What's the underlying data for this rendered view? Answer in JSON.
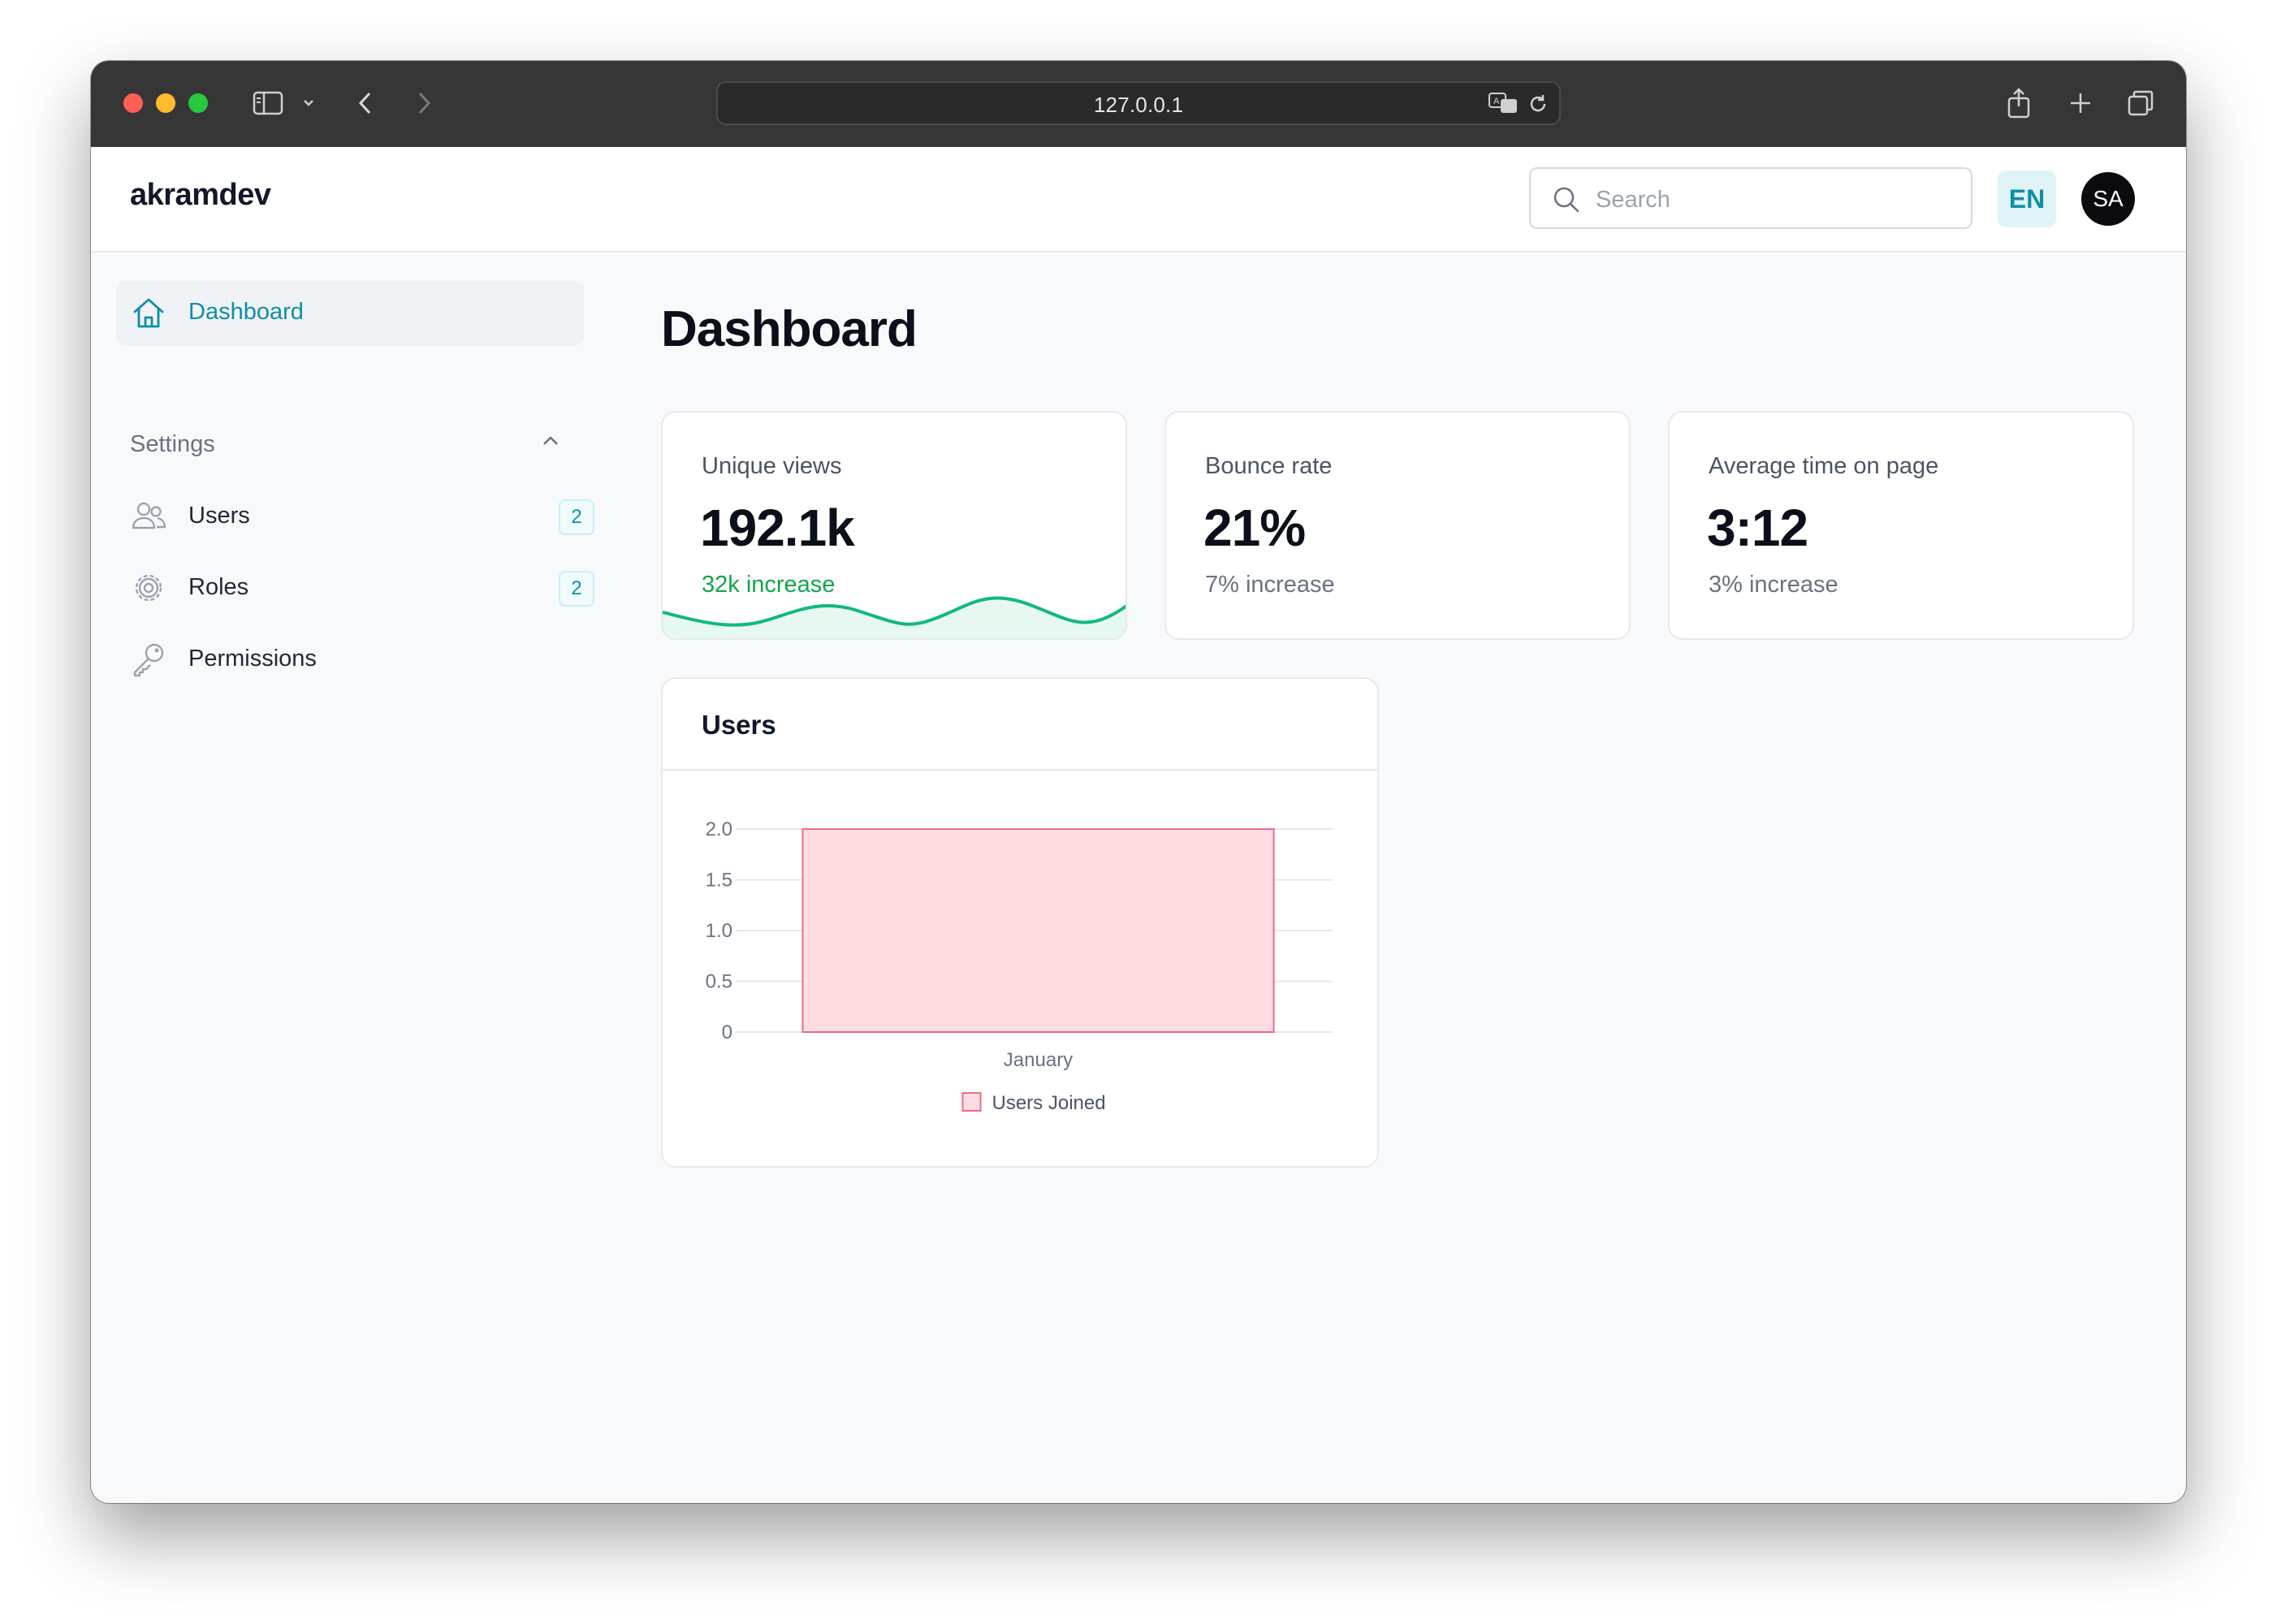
{
  "browser": {
    "url": "127.0.0.1"
  },
  "header": {
    "brand": "akramdev",
    "search_placeholder": "Search",
    "language": "EN",
    "avatar_initials": "SA"
  },
  "sidebar": {
    "active_item": {
      "label": "Dashboard",
      "icon": "home-icon"
    },
    "section": {
      "title": "Settings",
      "expanded": true,
      "items": [
        {
          "label": "Users",
          "icon": "users-icon",
          "badge": "2"
        },
        {
          "label": "Roles",
          "icon": "gear-icon",
          "badge": "2"
        },
        {
          "label": "Permissions",
          "icon": "key-icon",
          "badge": null
        }
      ]
    }
  },
  "main": {
    "title": "Dashboard",
    "stats": [
      {
        "title": "Unique views",
        "value": "192.1k",
        "delta": "32k increase",
        "delta_color": "#16a34a"
      },
      {
        "title": "Bounce rate",
        "value": "21%",
        "delta": "7% increase",
        "delta_color": "#6b7280"
      },
      {
        "title": "Average time on page",
        "value": "3:12",
        "delta": "3% increase",
        "delta_color": "#6b7280"
      }
    ],
    "users_card": {
      "title": "Users"
    }
  },
  "chart_data": {
    "type": "bar",
    "title": "",
    "categories": [
      "January"
    ],
    "series": [
      {
        "name": "Users Joined",
        "values": [
          2
        ],
        "fill": "#ffdde3",
        "stroke": "#f06a88"
      }
    ],
    "ylim": [
      0,
      2
    ],
    "yticks": [
      "2.0",
      "1.5",
      "1.0",
      "0.5",
      "0"
    ],
    "grid": true,
    "legend": "bottom"
  },
  "colors": {
    "accent": "#0e8fa8",
    "sparkline": "#10b981"
  }
}
